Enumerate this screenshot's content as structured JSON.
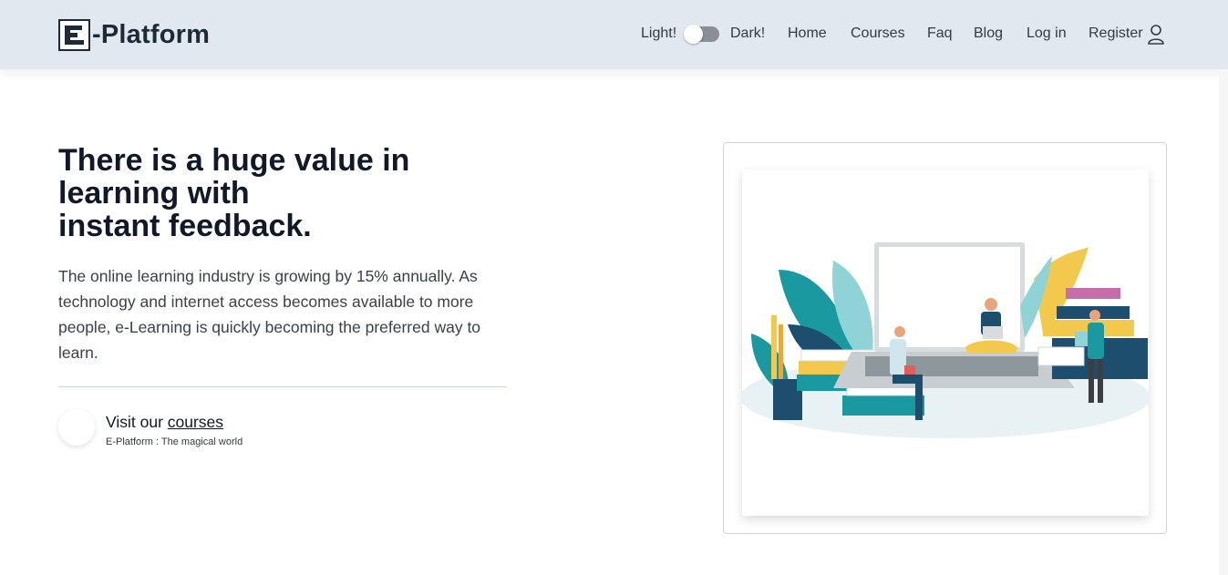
{
  "navbar": {
    "brand": "-Platform",
    "light_label": "Light!",
    "dark_label": "Dark!",
    "links": {
      "home": "Home",
      "courses": "Courses",
      "faq": "Faq",
      "blog": "Blog",
      "login": "Log in",
      "register": "Register"
    },
    "theme_toggle_on": false
  },
  "hero": {
    "title_line1": "There is a huge value in",
    "title_line2": "learning with",
    "title_line3": "instant feedback.",
    "paragraph": "The online learning industry is growing by 15% annually. As technology and internet access becomes available to more people, e-Learning is quickly becoming the preferred way to learn.",
    "visit_prefix": "Visit our ",
    "visit_link": "courses",
    "tagline": "E-Platform : The magical world"
  },
  "colors": {
    "navbar_bg": "#e2e8f0",
    "text_dark": "#111827",
    "teal": "#1a9aa0",
    "navy": "#1d4e6e",
    "yellow": "#f2c94c"
  }
}
